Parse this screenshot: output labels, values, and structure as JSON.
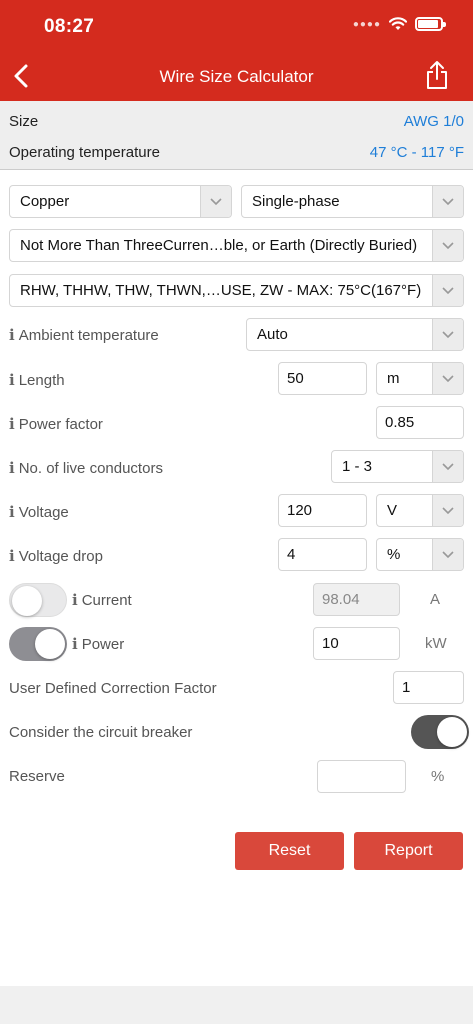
{
  "status": {
    "time": "08:27"
  },
  "header": {
    "title": "Wire Size Calculator"
  },
  "summary": {
    "size_label": "Size",
    "size_value": "AWG 1/0",
    "temp_label": "Operating temperature",
    "temp_value": "47 °C - 117 °F"
  },
  "selects": {
    "material": "Copper",
    "phase": "Single-phase",
    "installation": "Not More Than ThreeCurren…ble, or Earth (Directly Buried)",
    "insulation": "RHW, THHW, THW, THWN,…USE, ZW - MAX: 75°C(167°F)"
  },
  "fields": {
    "ambient_label": "Ambient temperature",
    "ambient_value": "Auto",
    "length_label": "Length",
    "length_value": "50",
    "length_unit": "m",
    "pf_label": "Power factor",
    "pf_value": "0.85",
    "conductors_label": "No. of live conductors",
    "conductors_value": "1 - 3",
    "voltage_label": "Voltage",
    "voltage_value": "120",
    "voltage_unit": "V",
    "vdrop_label": "Voltage drop",
    "vdrop_value": "4",
    "vdrop_unit": "%",
    "current_label": "Current",
    "current_value": "98.04",
    "current_unit": "A",
    "power_label": "Power",
    "power_value": "10",
    "power_unit": "kW",
    "ucf_label": "User Defined Correction Factor",
    "ucf_value": "1",
    "breaker_label": "Consider the circuit breaker",
    "reserve_label": "Reserve",
    "reserve_value": "",
    "reserve_unit": "%"
  },
  "info_glyph": "i",
  "buttons": {
    "reset": "Reset",
    "report": "Report"
  },
  "colors": {
    "brand": "#d42b1e",
    "accent": "#1e7ed8",
    "button": "#d9483b"
  }
}
